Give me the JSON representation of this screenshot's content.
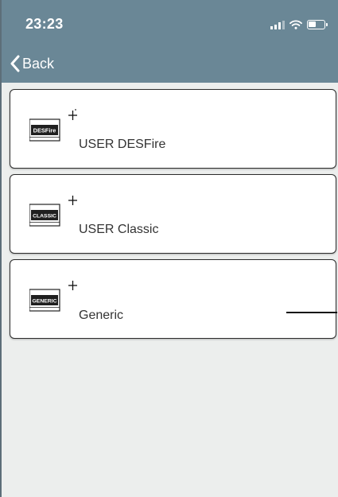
{
  "status_bar": {
    "time": "23:23",
    "icons": [
      "cellular-signal-icon",
      "wifi-icon",
      "battery-icon"
    ]
  },
  "nav": {
    "back_label": "Back"
  },
  "cards": [
    {
      "icon": "desfire-card-add-icon",
      "badge": "DESFire",
      "label": "USER DESFire"
    },
    {
      "icon": "classic-card-add-icon",
      "badge": "CLASSIC",
      "label": "USER Classic"
    },
    {
      "icon": "generic-card-add-icon",
      "badge": "GENERIC",
      "label": "Generic"
    }
  ],
  "colors": {
    "header": "#6a8796",
    "background": "#eceeed",
    "card": "#ffffff",
    "card_border": "#2c2c2c"
  }
}
